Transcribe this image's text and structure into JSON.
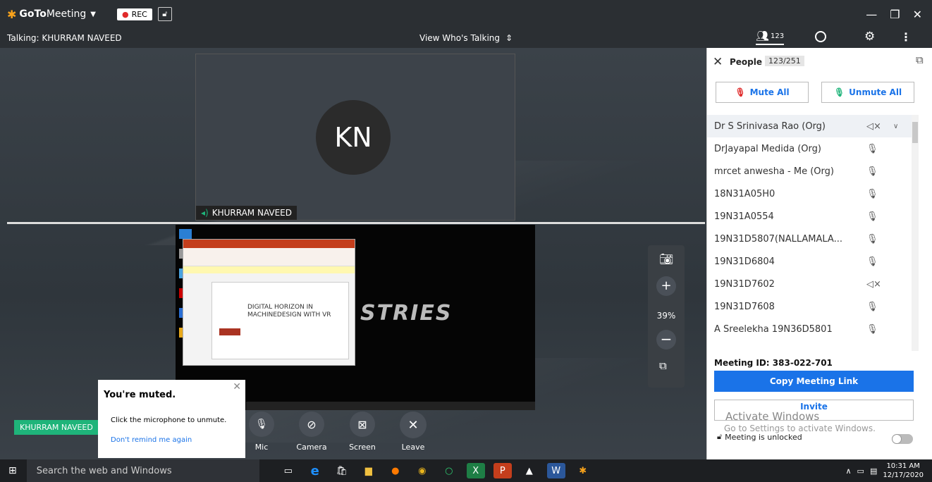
{
  "titlebar": {
    "app_name_bold": "GoTo",
    "app_name": "Meeting",
    "rec_label": "REC",
    "min_icon": "—",
    "restore_icon": "❐",
    "close_icon": "✕"
  },
  "toolbar": {
    "talking": "Talking: KHURRAM NAVEED",
    "view_label": "View Who's Talking",
    "people_count": "123"
  },
  "video": {
    "initials": "KN",
    "speaker_name": "KHURRAM NAVEED",
    "self_name": "KHURRAM NAVEED",
    "zoom": "39%",
    "slide_title_1": "DIGITAL HORIZON IN",
    "slide_title_2": "MACHINEDESIGN WITH VR",
    "screen_text": "STRIES"
  },
  "muted_popup": {
    "title": "You're muted.",
    "body": "Click the microphone to unmute.",
    "link": "Don't remind me again"
  },
  "controls": {
    "mic": "Mic",
    "camera": "Camera",
    "screen": "Screen",
    "leave": "Leave"
  },
  "people": {
    "title": "People",
    "count": "123/251",
    "mute_all": "Mute All",
    "unmute_all": "Unmute All",
    "list": [
      {
        "name": "Dr S Srinivasa Rao  (Org)",
        "status": "speaker-muted"
      },
      {
        "name": "DrJayapal Medida  (Org)",
        "status": "mic-muted"
      },
      {
        "name": "mrcet anwesha  - Me (Org)",
        "status": "mic-muted"
      },
      {
        "name": "18N31A05H0",
        "status": "mic-muted"
      },
      {
        "name": "19N31A0554",
        "status": "mic-muted"
      },
      {
        "name": "19N31D5807(NALLAMALA...",
        "status": "mic-muted"
      },
      {
        "name": "19N31D6804",
        "status": "mic-muted"
      },
      {
        "name": "19N31D7602",
        "status": "speaker-muted"
      },
      {
        "name": "19N31D7608",
        "status": "mic-muted"
      },
      {
        "name": "A Sreelekha 19N36D5801",
        "status": "mic-muted"
      }
    ],
    "meeting_id_label": "Meeting ID:",
    "meeting_id": "383-022-701",
    "copy_link": "Copy Meeting Link",
    "invite": "Invite",
    "activate_title": "Activate Windows",
    "activate_sub": "Go to Settings to activate Windows.",
    "meeting_unlocked": "Meeting is unlocked"
  },
  "taskbar": {
    "search": "Search the web and Windows",
    "time": "10:31 AM",
    "date": "12/17/2020"
  },
  "colors": {
    "accent": "#1a73e8",
    "red": "#e02a2a",
    "self_tag": "#1fb47a"
  }
}
